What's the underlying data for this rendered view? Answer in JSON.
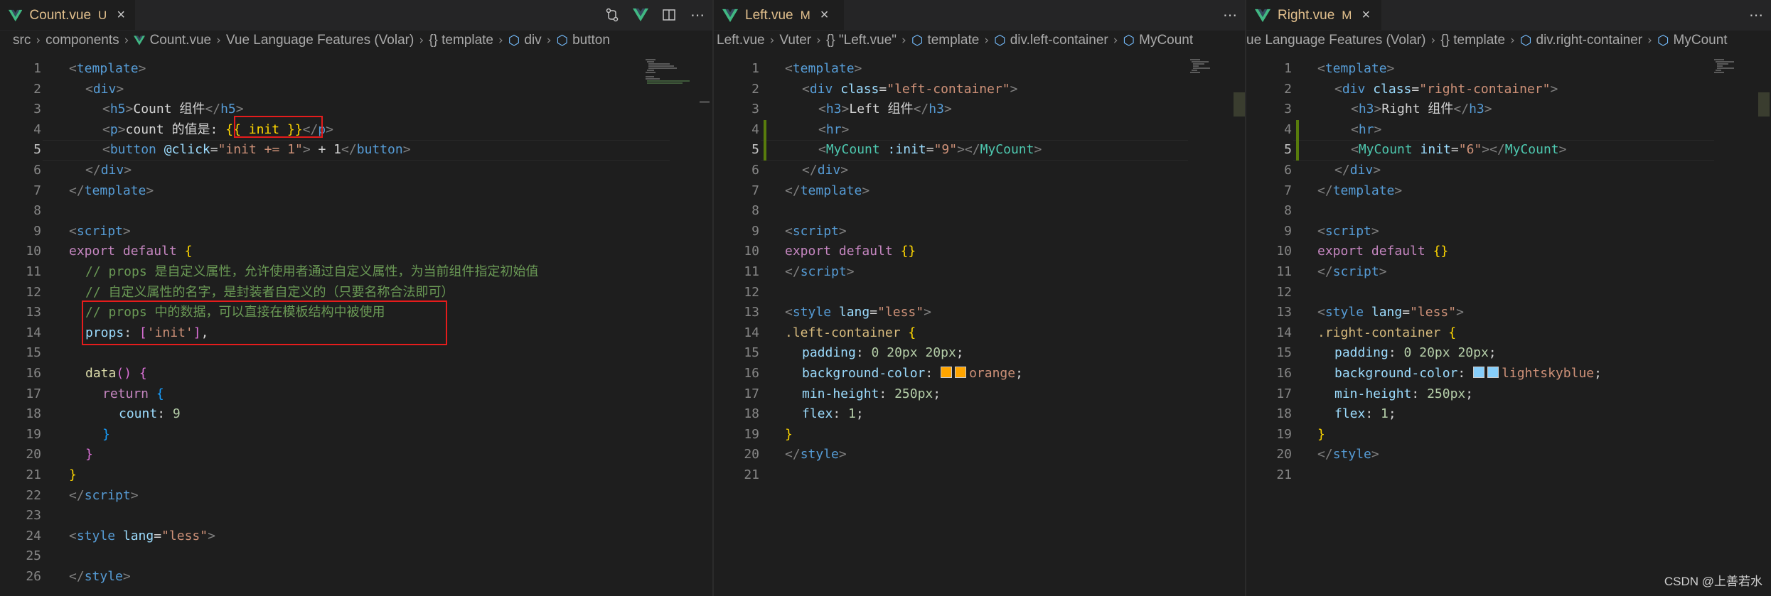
{
  "panes": [
    {
      "tab": {
        "name": "Count.vue",
        "status": "U",
        "close": "×"
      },
      "breadcrumb": [
        "src",
        "components",
        "Count.vue",
        "Vue Language Features (Volar)",
        "{} template",
        "div",
        "button"
      ],
      "actions": [
        "source-control-icon",
        "vue-devtools-icon",
        "split-editor-icon",
        "more-actions-icon"
      ]
    },
    {
      "tab": {
        "name": "Left.vue",
        "status": "M",
        "close": "×"
      },
      "breadcrumb": [
        "Left.vue",
        "Vuter",
        "{} \"Left.vue\"",
        "template",
        "div.left-container",
        "MyCount"
      ],
      "actions": [
        "more-actions-icon"
      ]
    },
    {
      "tab": {
        "name": "Right.vue",
        "status": "M",
        "close": "×"
      },
      "breadcrumb": [
        "ue Language Features (Volar)",
        "{} template",
        "div.right-container",
        "MyCount"
      ],
      "actions": [
        "more-actions-icon"
      ]
    }
  ],
  "lines": {
    "count": [
      "1",
      "2",
      "3",
      "4",
      "5",
      "6",
      "7",
      "8",
      "9",
      "10",
      "11",
      "12",
      "13",
      "14",
      "15",
      "16",
      "17",
      "18",
      "19",
      "20",
      "21",
      "22",
      "23",
      "24",
      "25",
      "26"
    ],
    "left": [
      "1",
      "2",
      "3",
      "4",
      "5",
      "6",
      "7",
      "8",
      "9",
      "10",
      "11",
      "12",
      "13",
      "14",
      "15",
      "16",
      "17",
      "18",
      "19",
      "20",
      "21"
    ],
    "right": [
      "1",
      "2",
      "3",
      "4",
      "5",
      "6",
      "7",
      "8",
      "9",
      "10",
      "11",
      "12",
      "13",
      "14",
      "15",
      "16",
      "17",
      "18",
      "19",
      "20",
      "21"
    ]
  },
  "code": {
    "count": {
      "l1": [
        "<",
        "template",
        ">"
      ],
      "l2": [
        "<",
        "div",
        ">"
      ],
      "l3": [
        "<",
        "h5",
        ">",
        "Count 组件",
        "</",
        "h5",
        ">"
      ],
      "l4": [
        "<",
        "p",
        ">",
        "count 的值是: ",
        "{{ init }}",
        "</",
        "p",
        ">"
      ],
      "l5": [
        "<",
        "button",
        " ",
        "@click",
        "=",
        "\"init += 1\"",
        ">",
        " + 1",
        "</",
        "button",
        ">"
      ],
      "l6": [
        "</",
        "div",
        ">"
      ],
      "l7": [
        "</",
        "template",
        ">"
      ],
      "l9": [
        "<",
        "script",
        ">"
      ],
      "l10": [
        "export",
        " ",
        "default",
        " ",
        "{"
      ],
      "l11": "// props 是自定义属性，允许使用者通过自定义属性，为当前组件指定初始值",
      "l12": "// 自定义属性的名字，是封装者自定义的（只要名称合法即可）",
      "l13": "// props 中的数据，可以直接在模板结构中被使用",
      "l14": [
        "props",
        ": ",
        "[",
        "'init'",
        "]",
        ","
      ],
      "l16": [
        "data",
        "(",
        ")",
        " ",
        "{"
      ],
      "l17": [
        "return",
        " ",
        "{"
      ],
      "l18": [
        "count",
        ": ",
        "9"
      ],
      "l19": "}",
      "l20": "}",
      "l21": "}",
      "l22": [
        "</",
        "script",
        ">"
      ],
      "l24": [
        "<",
        "style",
        " ",
        "lang",
        "=",
        "\"less\"",
        ">"
      ],
      "l26": [
        "</",
        "style",
        ">"
      ]
    },
    "left": {
      "l1": [
        "<",
        "template",
        ">"
      ],
      "l2": [
        "<",
        "div",
        " ",
        "class",
        "=",
        "\"left-container\"",
        ">"
      ],
      "l3": [
        "<",
        "h3",
        ">",
        "Left 组件",
        "</",
        "h3",
        ">"
      ],
      "l4": [
        "<",
        "hr",
        ">"
      ],
      "l5": [
        "<",
        "MyCount",
        " ",
        ":init",
        "=",
        "\"9\"",
        "></",
        "MyCount",
        ">"
      ],
      "l6": [
        "</",
        "div",
        ">"
      ],
      "l7": [
        "</",
        "template",
        ">"
      ],
      "l9": [
        "<",
        "script",
        ">"
      ],
      "l10": [
        "export",
        " ",
        "default",
        " ",
        "{}"
      ],
      "l11": [
        "</",
        "script",
        ">"
      ],
      "l13": [
        "<",
        "style",
        " ",
        "lang",
        "=",
        "\"less\"",
        ">"
      ],
      "l14": [
        ".left-container",
        " ",
        "{"
      ],
      "l15": [
        "padding",
        ": ",
        "0 ",
        "20px",
        " ",
        "20px",
        ";"
      ],
      "l16": [
        "background-color",
        ": ",
        "orange",
        ";"
      ],
      "l17": [
        "min-height",
        ": ",
        "250px",
        ";"
      ],
      "l18": [
        "flex",
        ": ",
        "1",
        ";"
      ],
      "l19": "}",
      "l20": [
        "</",
        "style",
        ">"
      ]
    },
    "right": {
      "l1": [
        "<",
        "template",
        ">"
      ],
      "l2": [
        "<",
        "div",
        " ",
        "class",
        "=",
        "\"right-container\"",
        ">"
      ],
      "l3": [
        "<",
        "h3",
        ">",
        "Right 组件",
        "</",
        "h3",
        ">"
      ],
      "l4": [
        "<",
        "hr",
        ">"
      ],
      "l5": [
        "<",
        "MyCount",
        " ",
        "init",
        "=",
        "\"6\"",
        "></",
        "MyCount",
        ">"
      ],
      "l6": [
        "</",
        "div",
        ">"
      ],
      "l7": [
        "</",
        "template",
        ">"
      ],
      "l9": [
        "<",
        "script",
        ">"
      ],
      "l10": [
        "export",
        " ",
        "default",
        " ",
        "{}"
      ],
      "l11": [
        "</",
        "script",
        ">"
      ],
      "l13": [
        "<",
        "style",
        " ",
        "lang",
        "=",
        "\"less\"",
        ">"
      ],
      "l14": [
        ".right-container",
        " ",
        "{"
      ],
      "l15": [
        "padding",
        ": ",
        "0 ",
        "20px",
        " ",
        "20px",
        ";"
      ],
      "l16": [
        "background-color",
        ": ",
        "lightskyblue",
        ";"
      ],
      "l17": [
        "min-height",
        ": ",
        "250px",
        ";"
      ],
      "l18": [
        "flex",
        ": ",
        "1",
        ";"
      ],
      "l19": "}",
      "l20": [
        "</",
        "style",
        ">"
      ]
    }
  },
  "swatches": {
    "orange": "#ffa500",
    "lightskyblue": "#87cefa"
  },
  "colors": {
    "background": "#1e1e1e",
    "highlight_box": "#e51c1c",
    "git_modified": "#587c0c"
  },
  "watermark": "CSDN @上善若水"
}
